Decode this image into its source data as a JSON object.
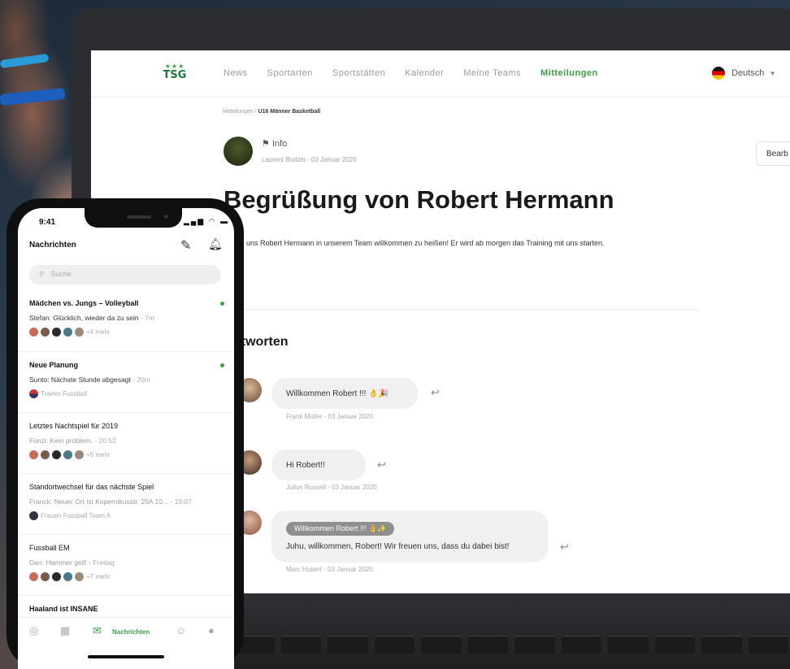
{
  "web": {
    "logo_text": "TSG",
    "nav": [
      "News",
      "Sportarten",
      "Sportstätten",
      "Kalender",
      "Meine Teams",
      "Mitteilungen"
    ],
    "active_nav": "Mitteilungen",
    "language": "Deutsch",
    "breadcrumb_parent": "Mitteilungen /",
    "breadcrumb_current": "U16 Männer Basketball",
    "post_tag": "Info",
    "post_meta": "Laurent Bodzin · 03 Januar 2020",
    "edit_label": "Bearb",
    "post_title": "Begrüßung von Robert Hermann",
    "post_body": "freuen uns Robert Hermann in unserem Team willkommen zu heißen! Er wird ab morgen das Training mit uns starten.",
    "answers_title": "ntworten",
    "replies": [
      {
        "text": "Willkommen Robert !!! 👌🎉",
        "meta": "Frank Müller · 03 Januar 2020"
      },
      {
        "text": "Hi Robert!!",
        "meta": "Julius Russell · 03 Januar 2020"
      },
      {
        "quote": "Willkommen Robert !!! 👌✨",
        "text": "Juhu, willkommen, Robert! Wir freuen uns, dass du dabei bist!",
        "meta": "Marc Hubert · 03 Januar 2020"
      }
    ]
  },
  "phone": {
    "time": "9:41",
    "status_icons": "▂▄▆ ◠ ▬",
    "title": "Nachrichten",
    "search_placeholder": "Suche",
    "messages": [
      {
        "title": "Mädchen vs. Jungs – Volleyball",
        "preview": "Stefan: Glücklich, wieder da zu sein",
        "time": "· 7m",
        "sub": "+4 mehr",
        "unread": true
      },
      {
        "title": "Neue Planung",
        "preview": "Sunto: Nächste Stunde abgesagt",
        "time": "· 20m",
        "sub": "Trainer Fussball",
        "unread": true
      },
      {
        "title": "Letztes Nachtspiel für 2019",
        "preview": "Fonzi: Kein problem.",
        "time": "· 20:52",
        "sub": "+5 mehr",
        "unread": false
      },
      {
        "title": "Standortwechsel für das nächste Spiel",
        "preview": "Franck: Neuer Ort ist Kopernikusstr. 25A 10...",
        "time": "· 19:07",
        "sub": "Frauen Fussball Team A",
        "unread": false
      },
      {
        "title": "Fussball EM",
        "preview": "Dan: Hammer geil!",
        "time": "· Freitag",
        "sub": "+7 mehr",
        "unread": false
      },
      {
        "title": "Haaland ist INSANE",
        "preview": "",
        "time": "",
        "sub": "",
        "unread": false
      }
    ],
    "tab_active_label": "Nachrichten",
    "colors": {
      "accent": "#3aa047"
    }
  }
}
